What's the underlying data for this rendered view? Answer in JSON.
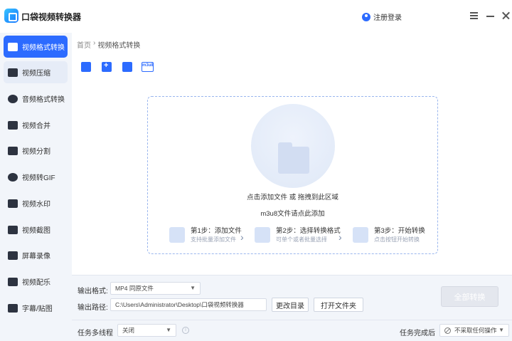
{
  "app": {
    "title": "口袋视频转换器",
    "login_label": "注册登录"
  },
  "sidebar": {
    "items": [
      {
        "label": "视频格式转换",
        "icon": "video-convert-icon"
      },
      {
        "label": "视频压缩",
        "icon": "video-compress-icon"
      },
      {
        "label": "音频格式转换",
        "icon": "audio-convert-icon"
      },
      {
        "label": "视频合并",
        "icon": "video-merge-icon"
      },
      {
        "label": "视频分割",
        "icon": "video-split-icon"
      },
      {
        "label": "视频转GIF",
        "icon": "gif-icon"
      },
      {
        "label": "视频水印",
        "icon": "watermark-icon"
      },
      {
        "label": "视频截图",
        "icon": "screenshot-icon"
      },
      {
        "label": "屏幕录像",
        "icon": "screen-record-icon"
      },
      {
        "label": "视频配乐",
        "icon": "music-icon"
      },
      {
        "label": "字幕/贴图",
        "icon": "subtitle-icon"
      }
    ]
  },
  "breadcrumb": {
    "home": "首页",
    "separator": "›",
    "current": "视频格式转换"
  },
  "toolbar": {
    "m3u8_label": "m3u8"
  },
  "dropzone": {
    "main_text": "点击添加文件 或 拖拽到此区域",
    "m3u8_text": "m3u8文件请点此添加",
    "steps": [
      {
        "title": "第1步：添加文件",
        "sub": "支持批量添加文件"
      },
      {
        "title": "第2步：选择转换格式",
        "sub": "可单个或者批量选择"
      },
      {
        "title": "第3步：开始转换",
        "sub": "点击按钮开始转换"
      }
    ],
    "arrow": "›"
  },
  "output": {
    "format_label": "输出格式:",
    "format_value": "MP4  同原文件",
    "path_label": "输出路径:",
    "path_value": "C:\\Users\\Administrator\\Desktop\\口袋视频转换器",
    "change_dir": "更改目录",
    "open_folder": "打开文件夹",
    "convert_all": "全部转换"
  },
  "task": {
    "thread_label": "任务多线程",
    "thread_value": "关闭",
    "after_label": "任务完成后",
    "after_value": "不采取任何操作"
  },
  "colors": {
    "accent": "#2c6bff",
    "sidebar_bg": "#f2f5fa"
  }
}
